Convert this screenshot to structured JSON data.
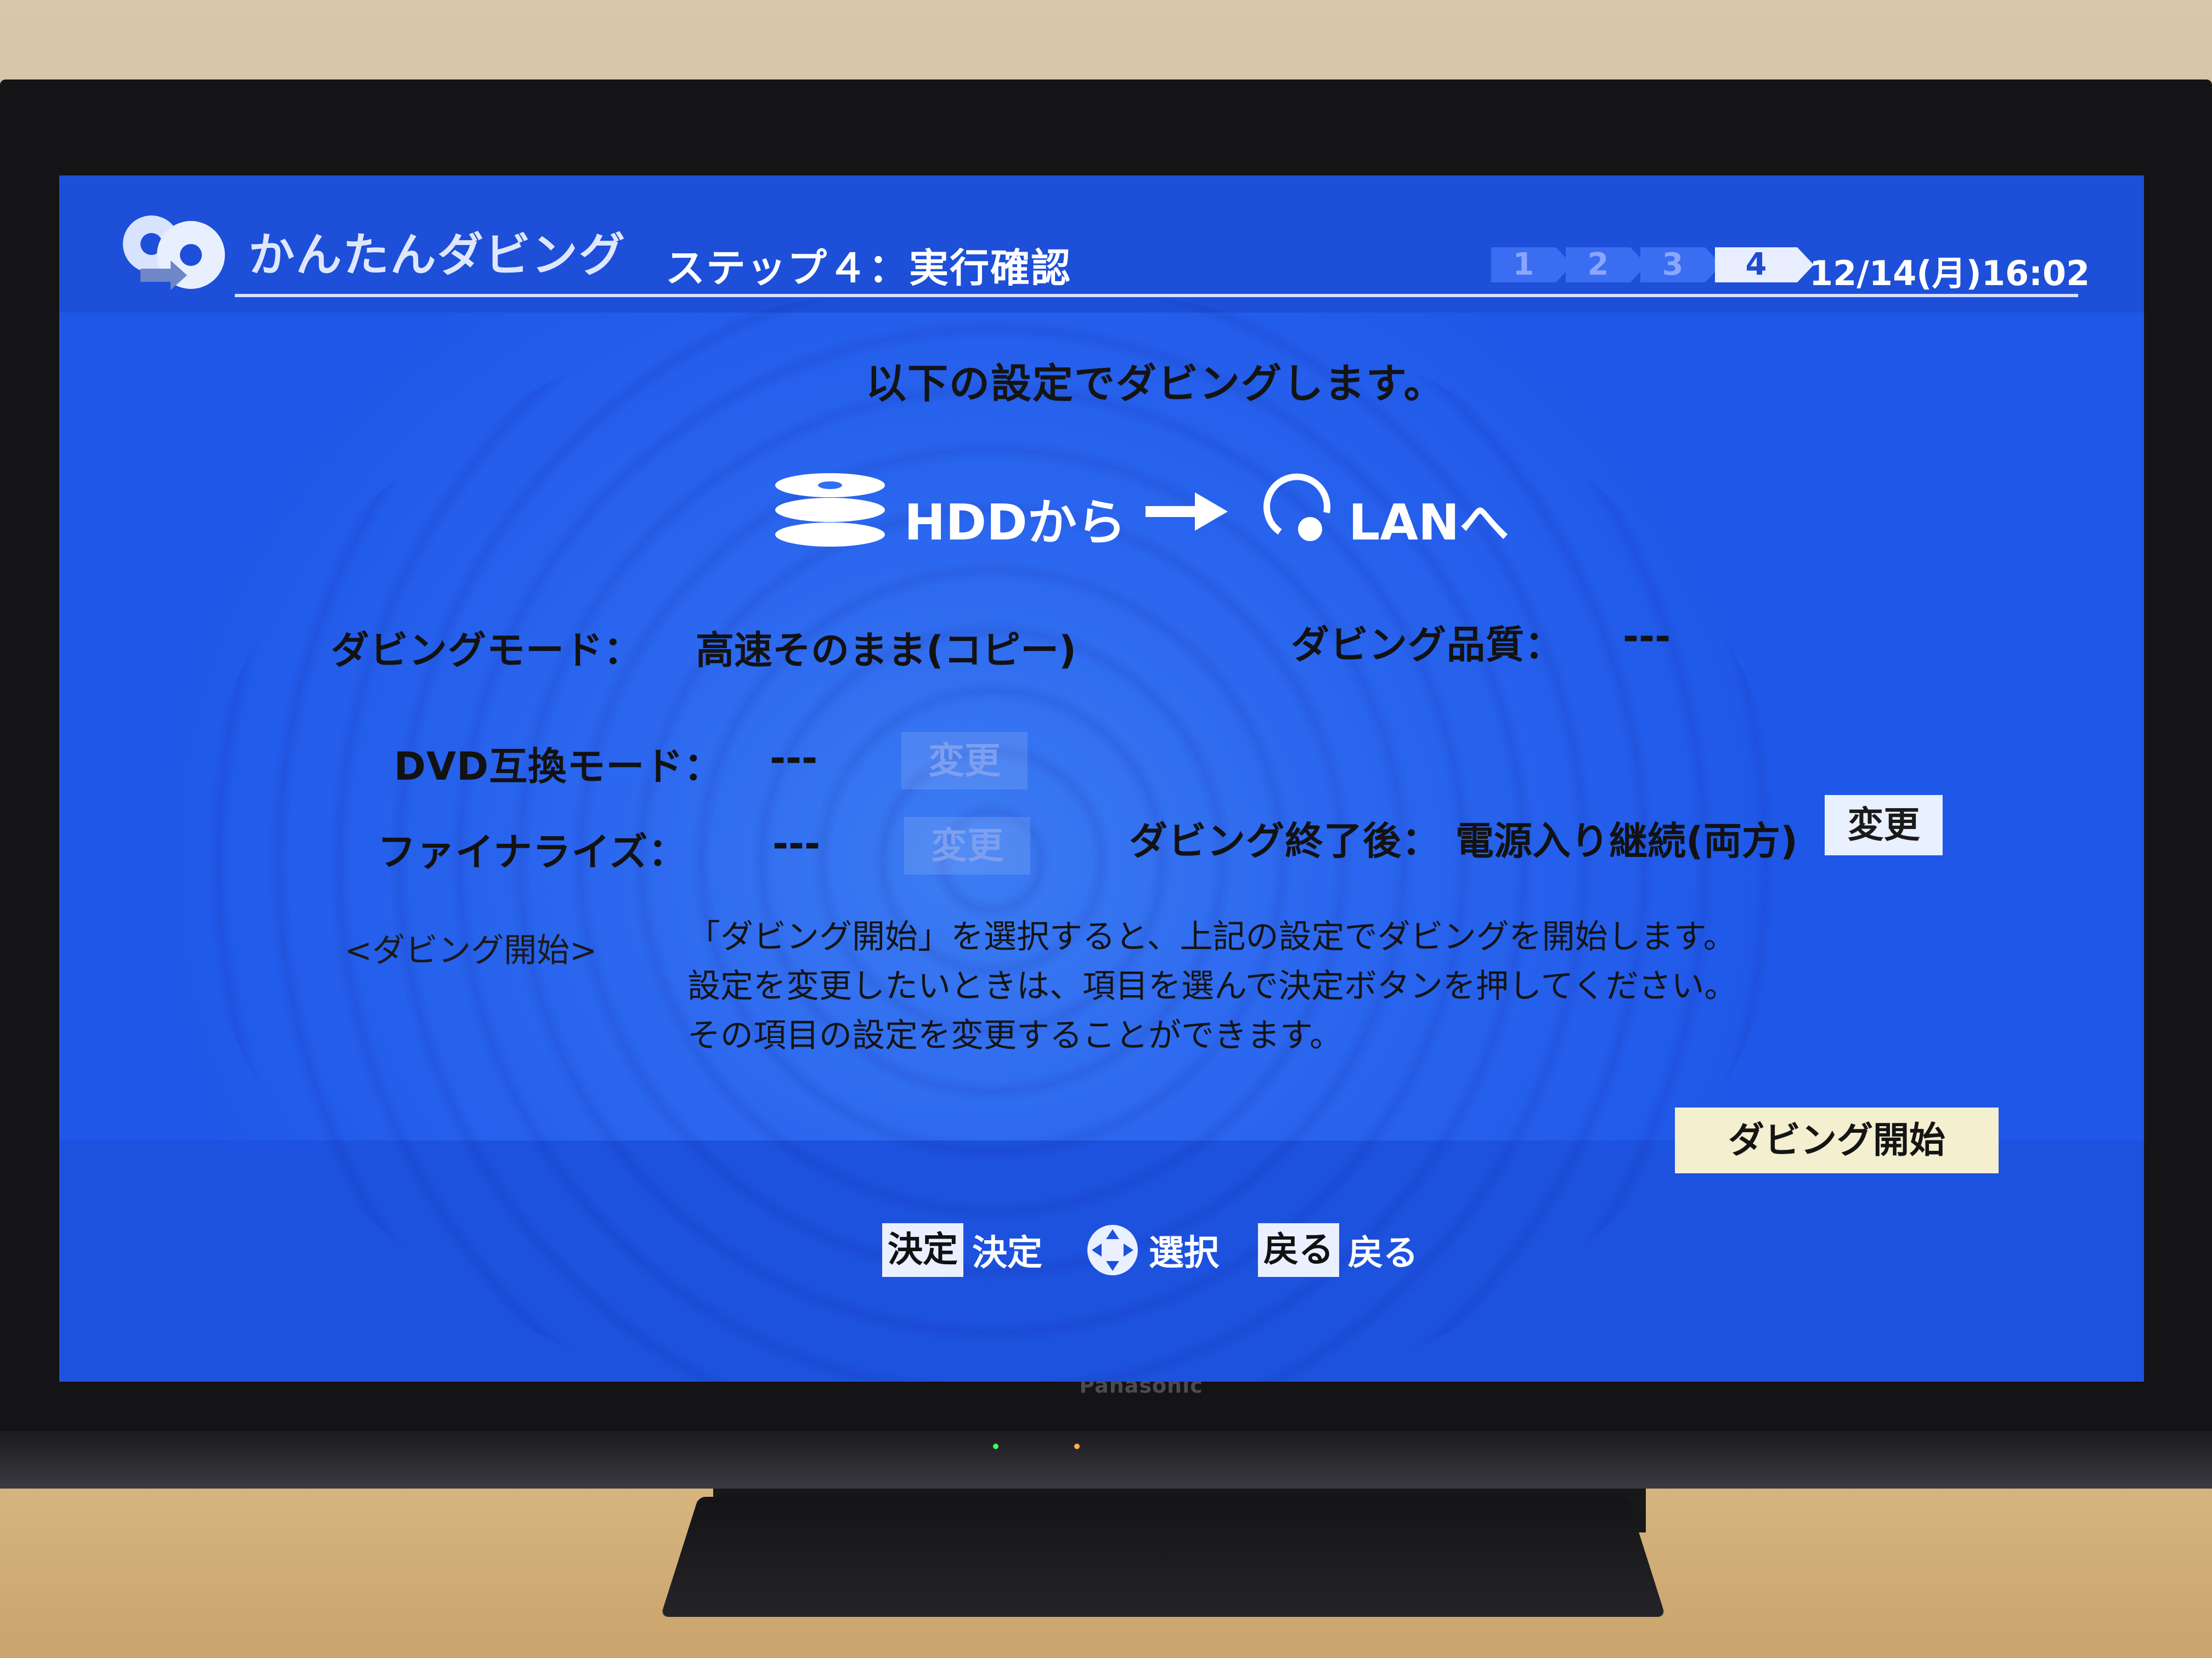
{
  "app": {
    "title": "かんたんダビング",
    "step_title": "ステップ４：実行確認",
    "datetime": "12/14(月)16:02",
    "steps": [
      "1",
      "2",
      "3",
      "4"
    ],
    "active_step": "4"
  },
  "main": {
    "intro": "以下の設定でダビングします。",
    "source": "HDDから",
    "destination": "LANへ",
    "dubbing_mode_label": "ダビングモード：",
    "dubbing_mode_value": "高速そのまま(コピー)",
    "dubbing_quality_label": "ダビング品質：",
    "dubbing_quality_value": "---",
    "dvd_mode_label": "DVD互換モード：",
    "dvd_mode_value": "---",
    "finalize_label": "ファイナライズ：",
    "finalize_value": "---",
    "after_label": "ダビング終了後：",
    "after_value": "電源入り継続(両方)",
    "change_label": "変更",
    "note_label": "<ダビング開始>",
    "note_lines": [
      "「ダビング開始」を選択すると、上記の設定でダビングを開始します。",
      "設定を変更したいときは、項目を選んで決定ボタンを押してください。",
      "その項目の設定を変更することができます。"
    ],
    "start_button": "ダビング開始"
  },
  "footer": {
    "keys": [
      {
        "key": "決定",
        "text": "決定"
      },
      {
        "key": "",
        "text": "選択"
      },
      {
        "key": "戻る",
        "text": "戻る"
      }
    ]
  },
  "tv": {
    "brand": "Panasonic"
  },
  "colors": {
    "screen_blue": "#1f58e8",
    "start_button": "#f3efcf"
  }
}
